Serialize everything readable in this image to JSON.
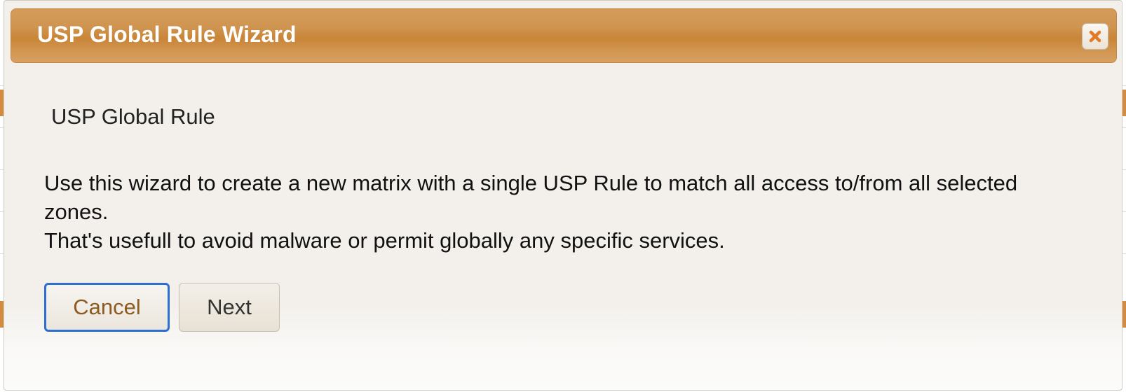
{
  "dialog": {
    "title": "USP Global Rule Wizard",
    "close_icon": "close-icon",
    "heading": "USP Global Rule",
    "description_line1": "Use this wizard to create a new matrix with a single USP Rule to match all access to/from all selected zones.",
    "description_line2": "That's usefull to avoid malware or permit globally any specific services.",
    "buttons": {
      "cancel": "Cancel",
      "next": "Next"
    }
  },
  "colors": {
    "titlebar": "#cf944f",
    "title_text": "#ffffff",
    "close_x": "#e07b2a",
    "focus_ring": "#2c6fd1",
    "cancel_text": "#8d5a1f"
  }
}
